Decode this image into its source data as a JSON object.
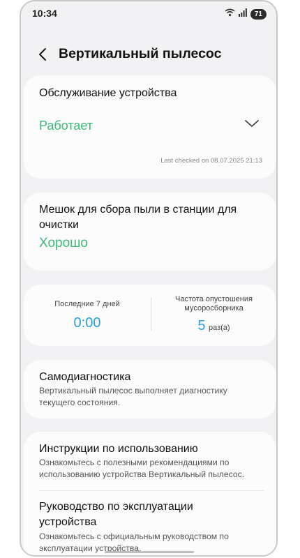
{
  "status_bar": {
    "time": "10:34",
    "battery": "71"
  },
  "header": {
    "title": "Вертикальный пылесос"
  },
  "maintenance": {
    "title": "Обслуживание устройства",
    "status": "Работает",
    "last_checked": "Last checked on 08.07.2025 21:13"
  },
  "dust_bag": {
    "title": "Мешок для сбора пыли в станции для очистки",
    "status": "Хорошо"
  },
  "stats": {
    "left_label": "Последние 7 дней",
    "left_value": "0:00",
    "right_label": "Частота опустошения мусоросборника",
    "right_value": "5",
    "right_unit": "раз(а)"
  },
  "self_diagnosis": {
    "title": "Самодиагностика",
    "description": "Вертикальный пылесос выполняет диагностику текущего состояния."
  },
  "instructions": {
    "title": "Инструкции по использованию",
    "description": "Ознакомьтесь с полезными рекомендациями по использованию устройства Вертикальный пылесос."
  },
  "manual": {
    "title": "Руководство по эксплуатации устройства",
    "description": "Ознакомьтесь с официальным руководством по эксплуатации устройства."
  },
  "colors": {
    "good_status": "#3cb878",
    "value_blue": "#2a9fd8",
    "background": "#f2f2f4",
    "card": "#fcfcfc"
  }
}
